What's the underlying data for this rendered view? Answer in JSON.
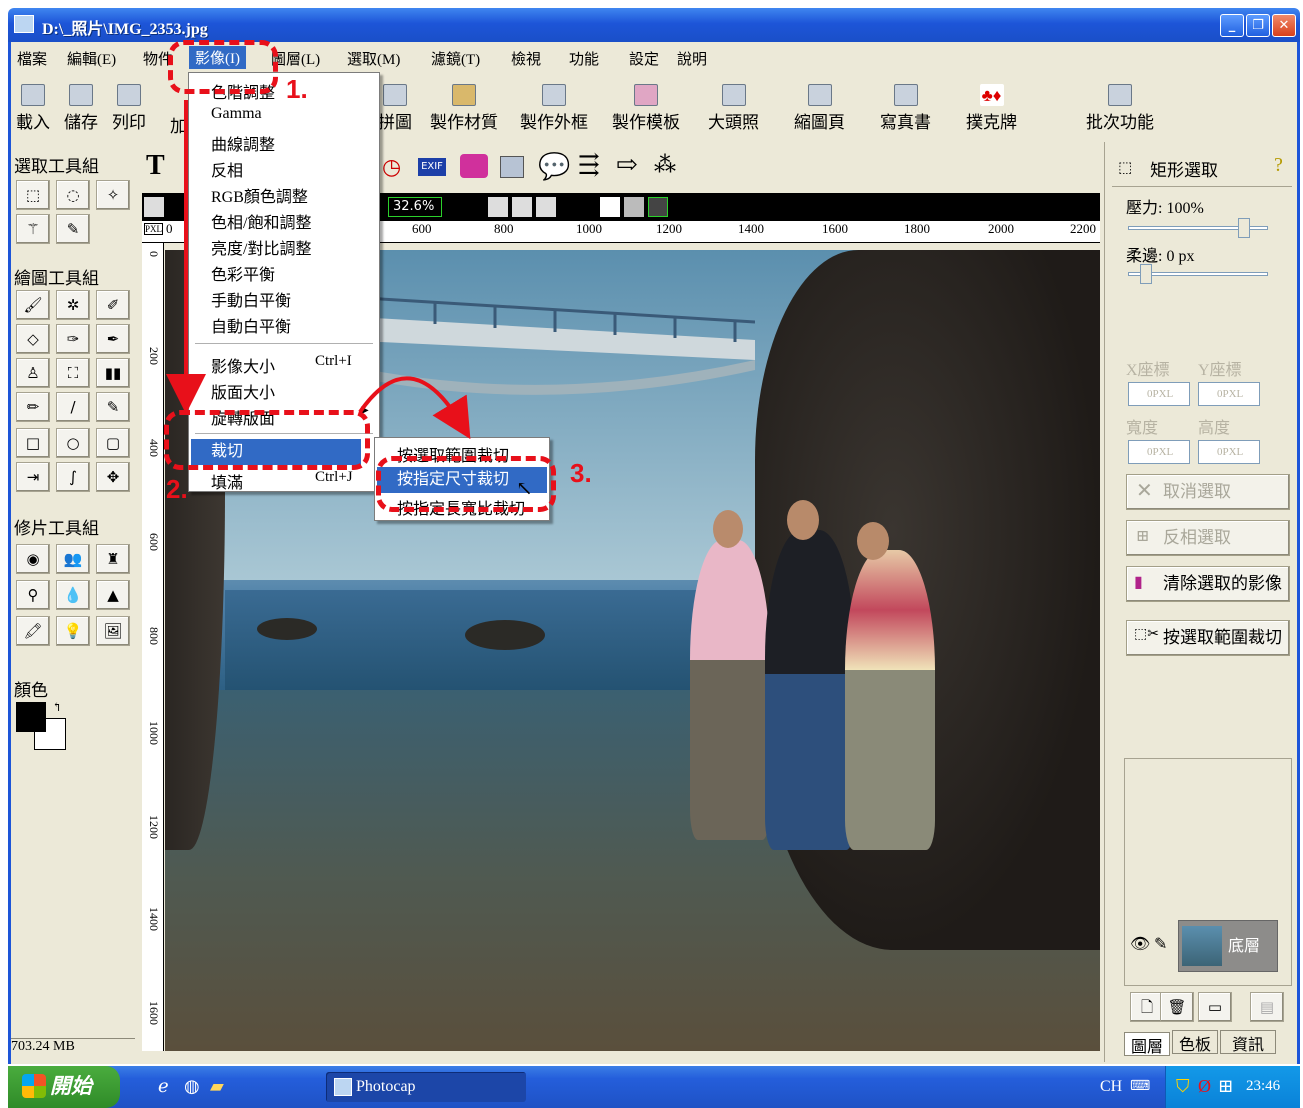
{
  "window": {
    "title": "D:\\_照片\\IMG_2353.jpg",
    "buttons": [
      "minimize",
      "restore",
      "close"
    ]
  },
  "menubar": {
    "items": [
      "檔案",
      "編輯(E)",
      "物件",
      "影像(I)",
      "圖層(L)",
      "選取(M)",
      "濾鏡(T)",
      "檢視",
      "功能",
      "設定",
      "說明"
    ]
  },
  "toolbar": {
    "items": [
      {
        "label": "載入",
        "icon": "open-folder-icon"
      },
      {
        "label": "儲存",
        "icon": "floppy-icon"
      },
      {
        "label": "列印",
        "icon": "printer-icon"
      },
      {
        "label": "加",
        "icon": "add-icon"
      },
      {
        "label": "拼圖",
        "icon": "collage-icon"
      },
      {
        "label": "製作材質",
        "icon": "texture-icon"
      },
      {
        "label": "製作外框",
        "icon": "frame-icon"
      },
      {
        "label": "製作模板",
        "icon": "template-icon"
      },
      {
        "label": "大頭照",
        "icon": "id-photo-icon"
      },
      {
        "label": "縮圖頁",
        "icon": "thumbnail-icon"
      },
      {
        "label": "寫真書",
        "icon": "photobook-icon"
      },
      {
        "label": "撲克牌",
        "icon": "poker-icon"
      },
      {
        "label": "批次功能",
        "icon": "batch-icon"
      }
    ]
  },
  "left_panel": {
    "select_group": "選取工具組",
    "draw_group": "繪圖工具組",
    "retouch_group": "修片工具組",
    "color_label": "顏色",
    "status": "703.24 MB"
  },
  "canvas": {
    "zoom": "32.6%",
    "ruler_h": [
      "0",
      "600",
      "800",
      "1000",
      "1200",
      "1400",
      "1600",
      "1800",
      "2000",
      "2200"
    ],
    "ruler_v": [
      "0",
      "200",
      "400",
      "600",
      "800",
      "1000",
      "1200",
      "1400",
      "1600"
    ],
    "unit": "PXL"
  },
  "image_menu": {
    "items": [
      {
        "label": "色階調整"
      },
      {
        "label": "Gamma"
      },
      {
        "label": "曲線調整"
      },
      {
        "label": "反相"
      },
      {
        "label": "RGB顏色調整"
      },
      {
        "label": "色相/飽和調整"
      },
      {
        "label": "亮度/對比調整"
      },
      {
        "label": "色彩平衡"
      },
      {
        "label": "手動白平衡"
      },
      {
        "label": "自動白平衡"
      },
      {
        "label": "影像大小",
        "shortcut": "Ctrl+I"
      },
      {
        "label": "版面大小"
      },
      {
        "label": "旋轉版面"
      },
      {
        "label": "裁切"
      },
      {
        "label": "填滿",
        "shortcut": "Ctrl+J"
      }
    ]
  },
  "crop_submenu": {
    "items": [
      "按選取範圍裁切",
      "按指定尺寸裁切",
      "按指定長寬比裁切"
    ]
  },
  "annotations": {
    "step1": "1.",
    "step2": "2.",
    "step3": "3."
  },
  "right_panel": {
    "tool_name": "矩形選取",
    "pressure": "壓力: 100%",
    "feather": "柔邊: 0 px",
    "x_label": "X座標",
    "y_label": "Y座標",
    "width_label": "寬度",
    "height_label": "高度",
    "x_value": "0",
    "y_value": "0",
    "w_value": "0",
    "h_value": "0",
    "unit": "PXL",
    "buttons": {
      "deselect": "取消選取",
      "invert": "反相選取",
      "clear": "清除選取的影像",
      "crop_selection": "按選取範圍裁切"
    },
    "layer_name": "底層",
    "tabs": [
      "圖層",
      "色板",
      "資訊"
    ]
  },
  "taskbar": {
    "start": "開始",
    "task": "Photocap",
    "lang": "CH",
    "time": "23:46"
  }
}
